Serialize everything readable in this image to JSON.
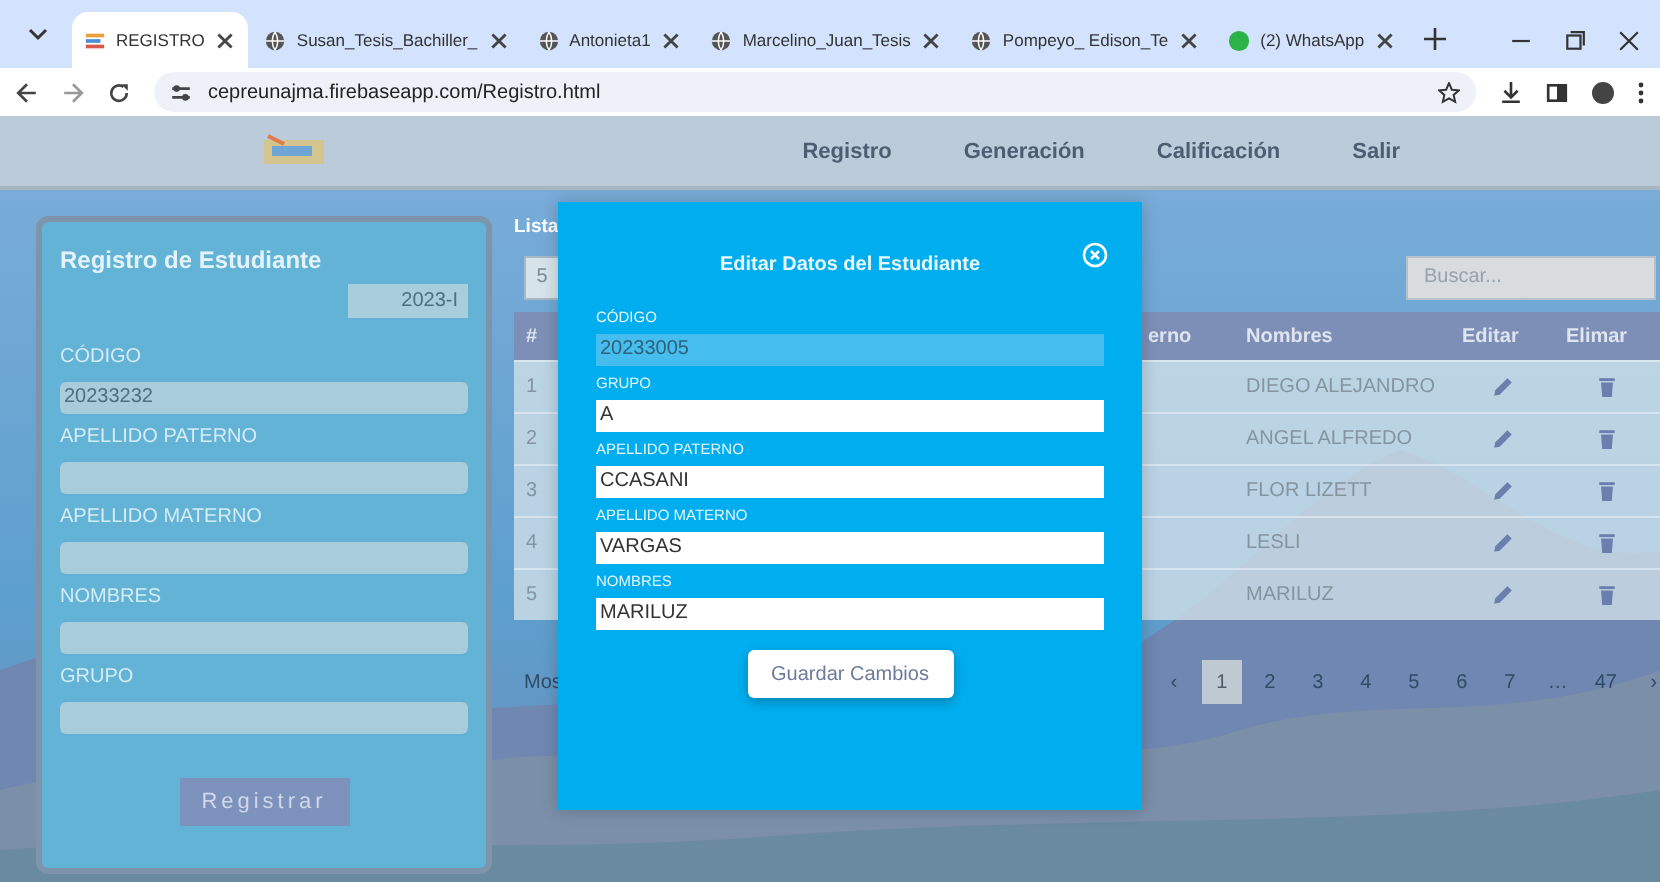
{
  "browser": {
    "tabs": [
      {
        "title": "REGISTRO",
        "selected": true
      },
      {
        "title": "Susan_Tesis_Bachiller_",
        "selected": false
      },
      {
        "title": "Antonieta1",
        "selected": false
      },
      {
        "title": "Marcelino_Juan_Tesis",
        "selected": false
      },
      {
        "title": "Pompeyo_ Edison_Te",
        "selected": false
      },
      {
        "title": "(2) WhatsApp",
        "selected": false
      }
    ],
    "url": "cepreunajma.firebaseapp.com/Registro.html"
  },
  "nav": {
    "items": [
      "Registro",
      "Generación",
      "Calificación",
      "Salir"
    ]
  },
  "register_form": {
    "title": "Registro de Estudiante",
    "period": "2023-I",
    "fields": [
      {
        "label": "CÓDIGO",
        "value": "20233232"
      },
      {
        "label": "APELLIDO PATERNO"
      },
      {
        "label": "APELLIDO MATERNO"
      },
      {
        "label": "NOMBRES"
      },
      {
        "label": "GRUPO"
      }
    ],
    "button": "Registrar"
  },
  "list": {
    "title": "Lista",
    "page_size": "5",
    "search_placeholder": "Buscar...",
    "columns": [
      "#",
      "erno",
      "Nombres",
      "Editar",
      "Elimar"
    ],
    "rows": [
      {
        "number": "1",
        "nombres": "DIEGO ALEJANDRO"
      },
      {
        "number": "2",
        "nombres": "ANGEL ALFREDO"
      },
      {
        "number": "3",
        "nombres": "FLOR LIZETT"
      },
      {
        "number": "4",
        "nombres": "LESLI"
      },
      {
        "number": "5",
        "nombres": "MARILUZ"
      }
    ],
    "info": "Mos",
    "pagination": [
      {
        "label": "‹",
        "selected": false
      },
      {
        "label": "1",
        "selected": true
      },
      {
        "label": "2",
        "selected": false
      },
      {
        "label": "3",
        "selected": false
      },
      {
        "label": "4",
        "selected": false
      },
      {
        "label": "5",
        "selected": false
      },
      {
        "label": "6",
        "selected": false
      },
      {
        "label": "7",
        "selected": false
      },
      {
        "label": "…",
        "selected": false
      },
      {
        "label": "47",
        "selected": false
      },
      {
        "label": "›",
        "selected": false
      }
    ]
  },
  "modal": {
    "title": "Editar Datos del Estudiante",
    "fields": [
      {
        "label": "CÓDIGO",
        "value": "20233005",
        "disabled": true
      },
      {
        "label": "GRUPO",
        "value": "A",
        "disabled": false
      },
      {
        "label": "APELLIDO PATERNO",
        "value": "CCASANI",
        "disabled": false
      },
      {
        "label": "APELLIDO MATERNO",
        "value": "VARGAS",
        "disabled": false
      },
      {
        "label": "NOMBRES",
        "value": "MARILUZ",
        "disabled": false
      }
    ],
    "button": "Guardar Cambios"
  }
}
